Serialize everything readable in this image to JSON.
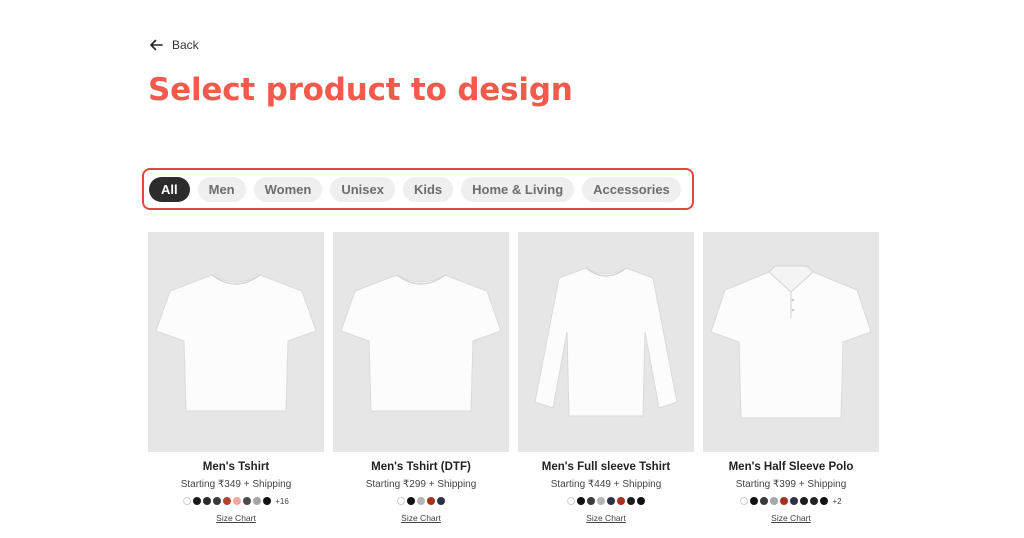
{
  "header": {
    "back_label": "Back",
    "title": "Select product to design"
  },
  "filters": [
    {
      "label": "All",
      "active": true,
      "name": "filter-all"
    },
    {
      "label": "Men",
      "active": false,
      "name": "filter-men"
    },
    {
      "label": "Women",
      "active": false,
      "name": "filter-women"
    },
    {
      "label": "Unisex",
      "active": false,
      "name": "filter-unisex"
    },
    {
      "label": "Kids",
      "active": false,
      "name": "filter-kids"
    },
    {
      "label": "Home & Living",
      "active": false,
      "name": "filter-home-living"
    },
    {
      "label": "Accessories",
      "active": false,
      "name": "filter-accessories"
    }
  ],
  "products": [
    {
      "name": "Men's Tshirt",
      "price": "Starting ₹349 + Shipping",
      "image_icon": "tshirt-icon",
      "colors": [
        "#ffffff",
        "#1a1a1a",
        "#2b2b2b",
        "#3a3a3a",
        "#b5432c",
        "#f1a7a0",
        "#4a4a4a",
        "#a6a6a6",
        "#111111"
      ],
      "more_colors": "+16",
      "size_chart_label": "Size Chart"
    },
    {
      "name": "Men's Tshirt (DTF)",
      "price": "Starting ₹299 + Shipping",
      "image_icon": "tshirt-icon",
      "colors": [
        "#ffffff",
        "#111111",
        "#b5b5b5",
        "#a8301f",
        "#2d3244"
      ],
      "more_colors": "",
      "size_chart_label": "Size Chart"
    },
    {
      "name": "Men's Full sleeve Tshirt",
      "price": "Starting ₹449 + Shipping",
      "image_icon": "long-sleeve-tshirt-icon",
      "colors": [
        "#ffffff",
        "#111111",
        "#3a3a3a",
        "#b5b5b5",
        "#2d3244",
        "#a8301f",
        "#1e1e1e",
        "#111111"
      ],
      "more_colors": "",
      "size_chart_label": "Size Chart"
    },
    {
      "name": "Men's Half Sleeve Polo",
      "price": "Starting ₹399 + Shipping",
      "image_icon": "polo-shirt-icon",
      "colors": [
        "#ffffff",
        "#111111",
        "#3a3a3a",
        "#a6a6a6",
        "#a8301f",
        "#2d3244",
        "#1a1a1a",
        "#222222",
        "#111111"
      ],
      "more_colors": "+2",
      "size_chart_label": "Size Chart"
    }
  ]
}
